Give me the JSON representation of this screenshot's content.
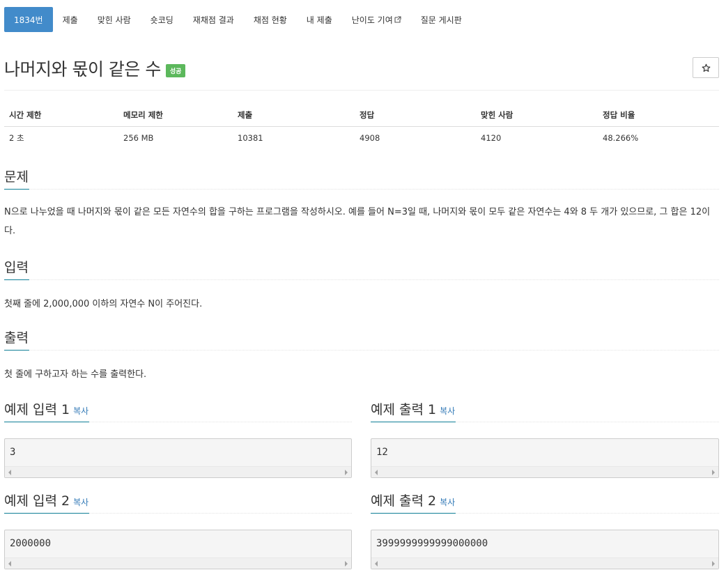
{
  "nav": {
    "items": [
      {
        "label": "1834번",
        "active": true
      },
      {
        "label": "제출"
      },
      {
        "label": "맞힌 사람"
      },
      {
        "label": "숏코딩"
      },
      {
        "label": "재채점 결과"
      },
      {
        "label": "채점 현황"
      },
      {
        "label": "내 제출"
      },
      {
        "label": "난이도 기여",
        "icon": "external-link-icon"
      },
      {
        "label": "질문 게시판"
      }
    ]
  },
  "problem": {
    "title": "나머지와 몫이 같은 수",
    "badge": "성공",
    "star_icon": "star-icon"
  },
  "info": {
    "headers": [
      "시간 제한",
      "메모리 제한",
      "제출",
      "정답",
      "맞힌 사람",
      "정답 비율"
    ],
    "values": [
      "2 초",
      "256 MB",
      "10381",
      "4908",
      "4120",
      "48.266%"
    ]
  },
  "sections": {
    "description": {
      "title": "문제",
      "text": "N으로 나누었을 때 나머지와 몫이 같은 모든 자연수의 합을 구하는 프로그램을 작성하시오. 예를 들어 N=3일 때, 나머지와 몫이 모두 같은 자연수는 4와 8 두 개가 있으므로, 그 합은 12이다."
    },
    "input": {
      "title": "입력",
      "text": "첫째 줄에 2,000,000 이하의 자연수 N이 주어진다."
    },
    "output": {
      "title": "출력",
      "text": "첫 줄에 구하고자 하는 수를 출력한다."
    }
  },
  "samples": {
    "copy_label": "복사",
    "input1": {
      "title": "예제 입력 1",
      "value": "3"
    },
    "output1": {
      "title": "예제 출력 1",
      "value": "12"
    },
    "input2": {
      "title": "예제 입력 2",
      "value": "2000000"
    },
    "output2": {
      "title": "예제 출력 2",
      "value": "3999999999999000000"
    }
  },
  "colors": {
    "nav_active": "#428bca",
    "badge_success": "#5cb85c",
    "section_underline": "#0e7e96",
    "link": "#337ab7"
  }
}
